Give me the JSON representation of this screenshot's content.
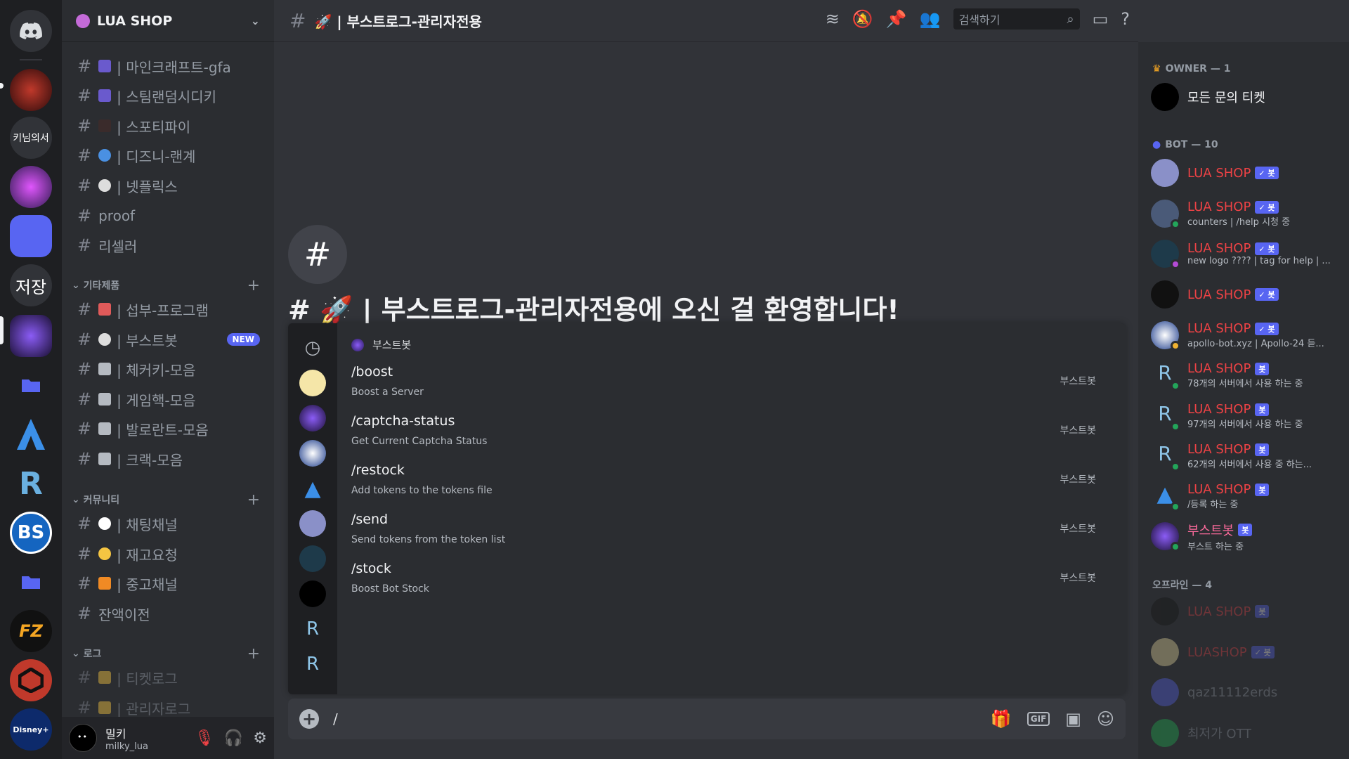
{
  "guild": {
    "name": "LUA SHOP"
  },
  "rail": {
    "servers": [
      {
        "name": "discord-home",
        "label": ""
      },
      {
        "name": "server-1",
        "label": ""
      },
      {
        "name": "server-kimnim",
        "label": "키님의서"
      },
      {
        "name": "server-2",
        "label": ""
      },
      {
        "name": "server-3",
        "label": ""
      },
      {
        "name": "server-jeojang",
        "label": "저장"
      },
      {
        "name": "server-lua",
        "label": ""
      },
      {
        "name": "folder-1",
        "label": ""
      },
      {
        "name": "server-apollo",
        "label": ""
      },
      {
        "name": "server-r",
        "label": ""
      },
      {
        "name": "server-bs",
        "label": "BS"
      },
      {
        "name": "folder-2",
        "label": ""
      },
      {
        "name": "server-fz",
        "label": "FZ"
      },
      {
        "name": "server-red",
        "label": ""
      },
      {
        "name": "server-disney",
        "label": "Disney+"
      }
    ]
  },
  "channels": {
    "top": [
      {
        "label": "| 마인크래프트-gfa",
        "emoji_color": "#6a5acd"
      },
      {
        "label": "| 스팀랜덤시디키",
        "emoji_color": "#6a5acd"
      },
      {
        "label": "| 스포티파이",
        "emoji_color": "#3a2b2b"
      },
      {
        "label": "| 디즈니-랜계",
        "emoji_color": "#4a90e2"
      },
      {
        "label": "| 넷플릭스",
        "emoji_color": "#dddddd"
      },
      {
        "label": "proof",
        "emoji_color": ""
      },
      {
        "label": "리셀러",
        "emoji_color": ""
      }
    ],
    "cat_etc": "기타제품",
    "etc": [
      {
        "label": "| 섭부-프로그램",
        "emoji_color": "#e05a5a"
      },
      {
        "label": "| 부스트봇",
        "emoji_color": "#dddddd",
        "badge": "NEW"
      },
      {
        "label": "| 체커키-모음",
        "emoji_color": "#b5bac1"
      },
      {
        "label": "| 게임핵-모음",
        "emoji_color": "#b5bac1"
      },
      {
        "label": "| 발로란트-모음",
        "emoji_color": "#b5bac1"
      },
      {
        "label": "| 크랙-모음",
        "emoji_color": "#b5bac1"
      }
    ],
    "cat_community": "커뮤니티",
    "community": [
      {
        "label": "| 채팅채널",
        "emoji_color": "#ffffff"
      },
      {
        "label": "| 재고요청",
        "emoji_color": "#f5c542"
      },
      {
        "label": "| 중고채널",
        "emoji_color": "#f08a24"
      },
      {
        "label": "잔액이전",
        "emoji_color": ""
      }
    ],
    "cat_log": "로그",
    "log": [
      {
        "label": "| 티켓로그",
        "emoji_color": "#f5c542"
      },
      {
        "label": "| 관리자로그",
        "emoji_color": "#f5c542"
      }
    ]
  },
  "user": {
    "display": "밀키",
    "tag": "milky_lua"
  },
  "chat": {
    "channel_title": "🚀 | 부스트로그-관리자전용",
    "welcome": "# 🚀 | 부스트로그-관리자전용에 오신 걸 환영합니다!",
    "search_placeholder": "검색하기",
    "composer_text": "/"
  },
  "commands": {
    "section": "부스트봇",
    "items": [
      {
        "name": "/boost",
        "desc": "Boost a Server",
        "source": "부스트봇"
      },
      {
        "name": "/captcha-status",
        "desc": "Get Current Captcha Status",
        "source": "부스트봇"
      },
      {
        "name": "/restock",
        "desc": "Add tokens to the tokens file",
        "source": "부스트봇"
      },
      {
        "name": "/send",
        "desc": "Send tokens from the token list",
        "source": "부스트봇"
      },
      {
        "name": "/stock",
        "desc": "Boost Bot Stock",
        "source": "부스트봇"
      }
    ]
  },
  "members": {
    "owner_cat": "OWNER — 1",
    "owner": {
      "name": "모든 문의 티켓",
      "tag": ""
    },
    "bot_cat": "BOT — 10",
    "bots": [
      {
        "name": "LUA SHOP",
        "tag": "✓ 봇",
        "status": ""
      },
      {
        "name": "LUA SHOP",
        "tag": "✓ 봇",
        "status": "counters | /help 시청 중"
      },
      {
        "name": "LUA SHOP",
        "tag": "✓ 봇",
        "status": "new logo ???? | tag for help | ..."
      },
      {
        "name": "LUA SHOP",
        "tag": "✓ 봇",
        "status": ""
      },
      {
        "name": "LUA SHOP",
        "tag": "✓ 봇",
        "status": "apollo-bot.xyz | Apollo-24 듣..."
      },
      {
        "name": "LUA SHOP",
        "tag": "봇",
        "status": "78개의 서버에서 사용 하는 중"
      },
      {
        "name": "LUA SHOP",
        "tag": "봇",
        "status": "97개의 서버에서 사용 하는 중"
      },
      {
        "name": "LUA SHOP",
        "tag": "봇",
        "status": "62개의 서버에서 사용 중 하는..."
      },
      {
        "name": "LUA SHOP",
        "tag": "봇",
        "status": "/등록 하는 중"
      },
      {
        "name": "부스트봇",
        "tag": "봇",
        "status": "부스트 하는 중"
      }
    ],
    "offline_cat": "오프라인 — 4",
    "offline": [
      {
        "name": "LUA SHOP",
        "tag": "봇"
      },
      {
        "name": "LUASHOP",
        "tag": "✓ 봇"
      },
      {
        "name": "qaz11112erds",
        "tag": ""
      },
      {
        "name": "최저가 OTT",
        "tag": ""
      }
    ]
  },
  "colors": {
    "accent": "#5865f2",
    "bot_name": "#ed4245",
    "online": "#23a55a"
  }
}
